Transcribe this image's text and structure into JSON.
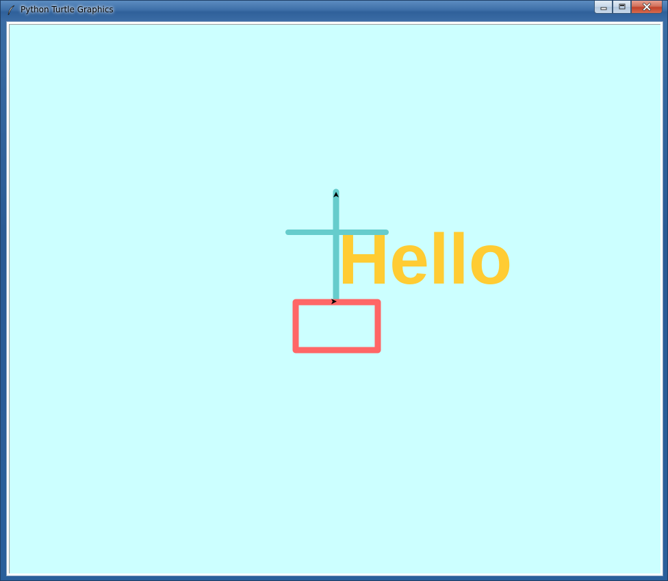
{
  "window": {
    "title": "Python Turtle Graphics",
    "icon": "feather-icon"
  },
  "controls": {
    "minimize_icon": "minimize-icon",
    "maximize_icon": "maximize-icon",
    "close_icon": "close-icon"
  },
  "canvas": {
    "background": "#ccffff",
    "text": "Hello",
    "text_color": "#ffcc33",
    "cross_color": "#66cccc",
    "rect_color": "#ff6666",
    "turtle_color": "#000000"
  }
}
